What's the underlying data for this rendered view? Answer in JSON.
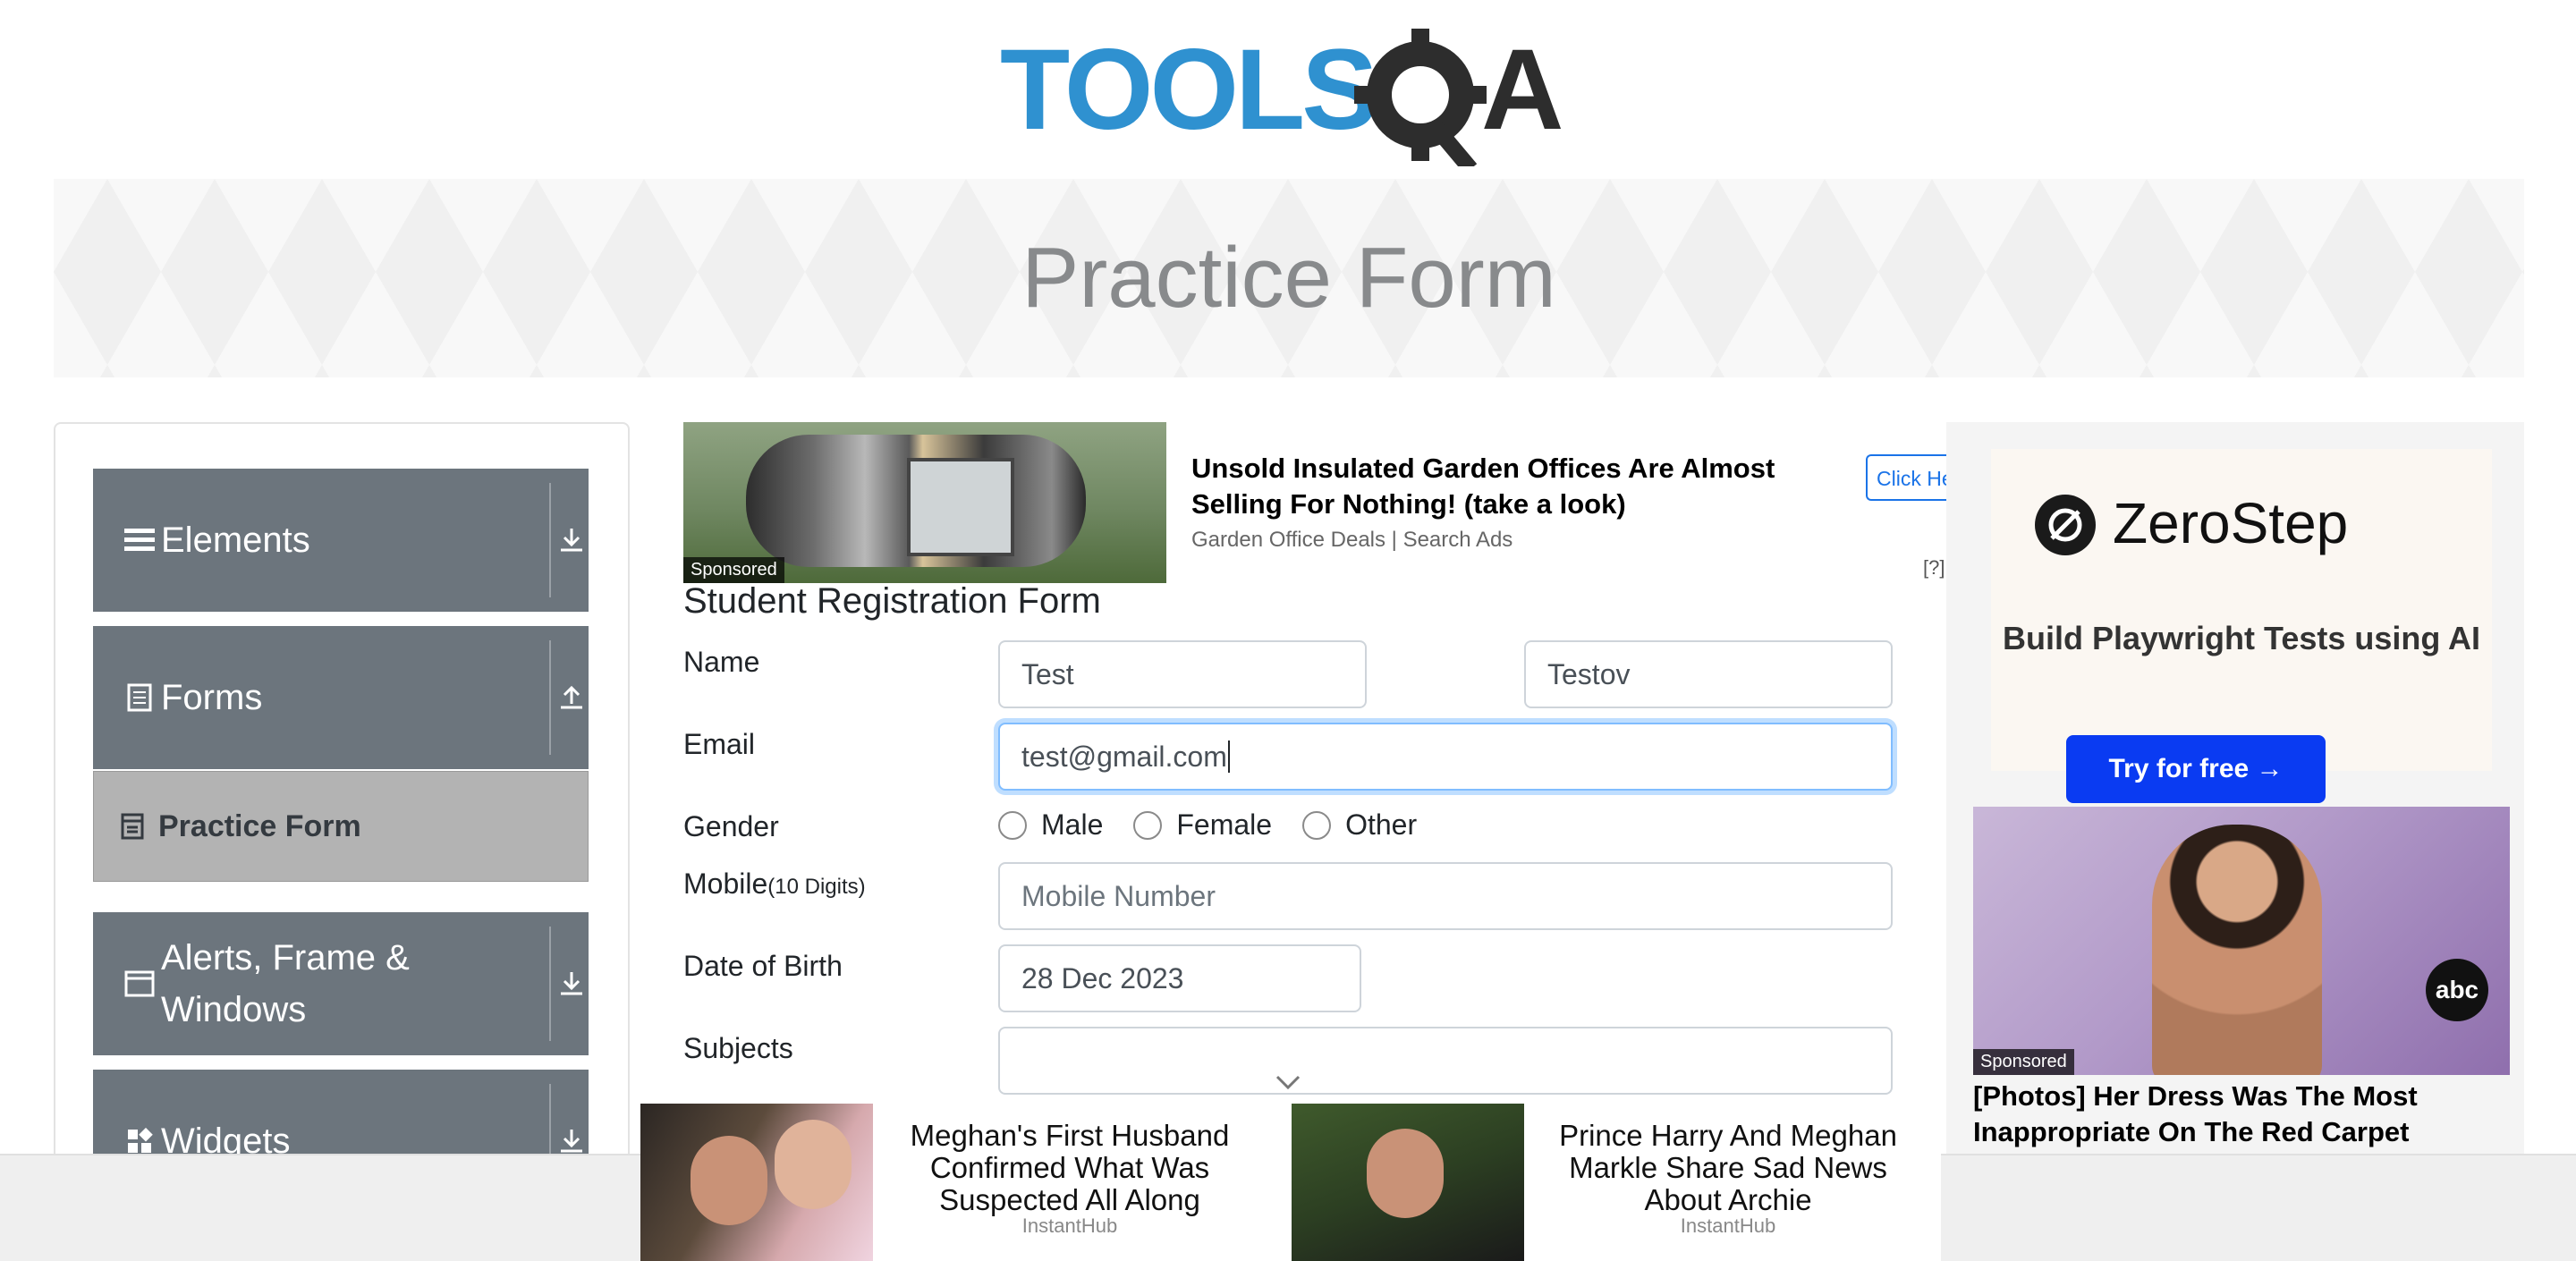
{
  "header": {
    "logo_text": "TOOLSQA",
    "banner_title": "Practice Form"
  },
  "sidebar": {
    "groups": [
      {
        "label": "Elements",
        "icon": "menu-lines-icon",
        "arrow": "download-arrow-icon"
      },
      {
        "label": "Forms",
        "icon": "document-icon",
        "arrow": "upload-arrow-icon"
      },
      {
        "label": "Alerts, Frame & Windows",
        "icon": "window-icon",
        "arrow": "download-arrow-icon"
      },
      {
        "label": "Widgets",
        "icon": "widgets-icon",
        "arrow": "download-arrow-icon"
      }
    ],
    "active_item": {
      "label": "Practice Form",
      "icon": "form-icon"
    }
  },
  "top_ad": {
    "title": "Unsold Insulated Garden Offices Are Almost Selling For Nothing! (take a look)",
    "source": "Garden Office Deals | Search Ads",
    "cta": "Click He",
    "sponsored": "Sponsored",
    "info": "[?]"
  },
  "form": {
    "title": "Student Registration Form",
    "labels": {
      "name": "Name",
      "email": "Email",
      "gender": "Gender",
      "mobile": "Mobile",
      "mobile_hint": "(10 Digits)",
      "dob": "Date of Birth",
      "subjects": "Subjects"
    },
    "first_name": "Test",
    "last_name": "Testov",
    "email": "test@gmail.com",
    "gender_options": [
      "Male",
      "Female",
      "Other"
    ],
    "mobile_placeholder": "Mobile Number",
    "dob": "28 Dec 2023",
    "subjects": ""
  },
  "right_ad": {
    "brand": "ZeroStep",
    "tagline": "Build Playwright Tests using AI",
    "cta": "Try for free →",
    "sponsored": "Sponsored",
    "photo_title": "[Photos] Her Dress Was The Most Inappropriate On The Red Carpet",
    "abc_logo": "abc"
  },
  "bottom_ads": [
    {
      "title": "Meghan's First Husband Confirmed What Was Suspected All Along",
      "source": "InstantHub"
    },
    {
      "title": "Prince Harry And Meghan Markle Share Sad News About Archie",
      "source": "InstantHub"
    }
  ],
  "colors": {
    "sidebar_group": "#6c757d",
    "active_item": "#b3b3b3",
    "logo_blue": "#2f91d0",
    "logo_dark": "#2d2d2d",
    "cta_blue": "#0a3bf2"
  }
}
